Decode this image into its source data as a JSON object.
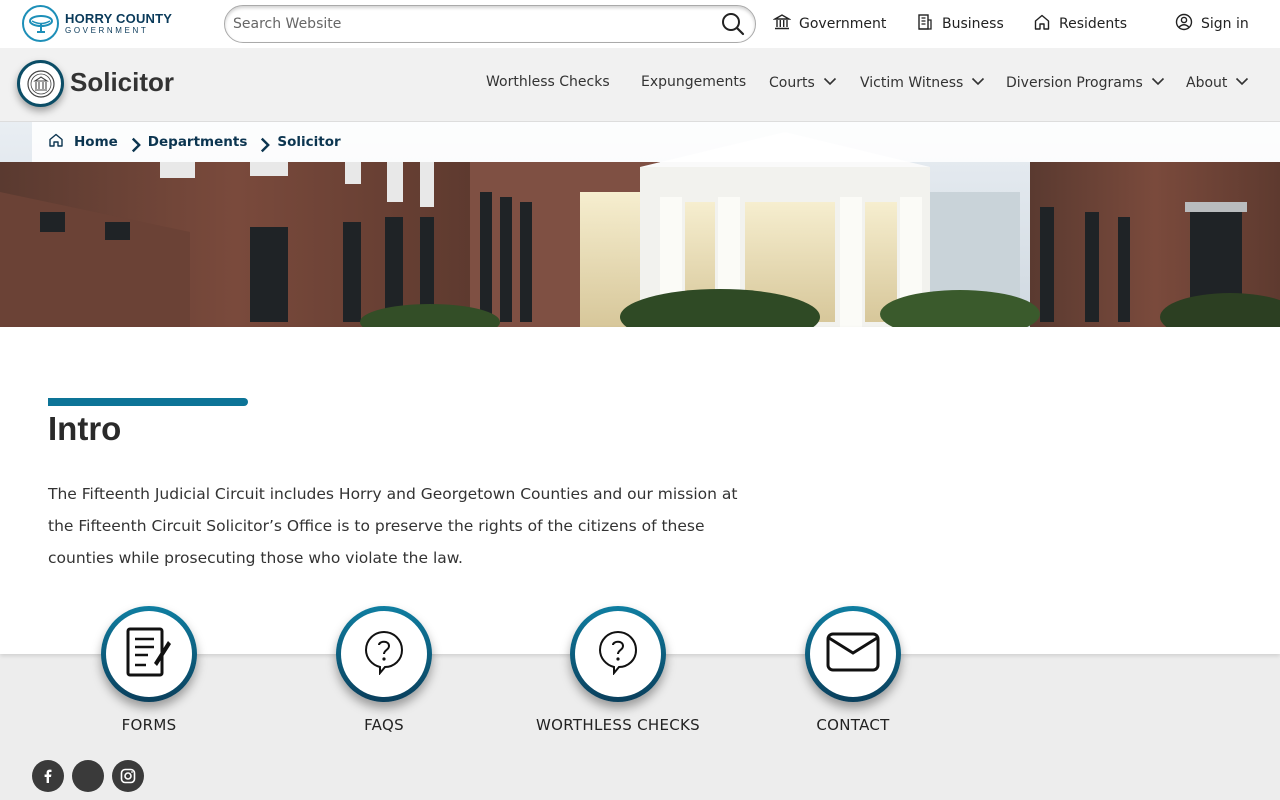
{
  "topbar": {
    "logo_line1": "HORRY COUNTY",
    "logo_line2": "GOVERNMENT",
    "search_placeholder": "Search Website",
    "links": [
      {
        "label": "Government",
        "icon": "government-building-icon"
      },
      {
        "label": "Business",
        "icon": "office-building-icon"
      },
      {
        "label": "Residents",
        "icon": "house-icon"
      },
      {
        "label": "Sign in",
        "icon": "user-circle-icon"
      }
    ]
  },
  "site": {
    "title": "Solicitor",
    "nav": [
      {
        "label": "Worthless Checks",
        "dropdown": false
      },
      {
        "label": "Expungements",
        "dropdown": false
      },
      {
        "label": "Courts",
        "dropdown": true
      },
      {
        "label": "Victim Witness",
        "dropdown": true
      },
      {
        "label": "Diversion Programs",
        "dropdown": true
      },
      {
        "label": "About",
        "dropdown": true
      }
    ]
  },
  "breadcrumb": [
    "Home",
    "Departments",
    "Solicitor"
  ],
  "intro": {
    "heading": "Intro",
    "text": "The Fifteenth Judicial Circuit includes Horry and Georgetown Counties and our mission at the Fifteenth Circuit Solicitor’s Office is to preserve the rights of the citizens of these counties while prosecuting those who violate the law."
  },
  "quicklinks": [
    {
      "label": "FORMS",
      "icon": "form-edit-icon"
    },
    {
      "label": "FAQS",
      "icon": "question-bubble-icon"
    },
    {
      "label": "WORTHLESS CHECKS",
      "icon": "question-bubble-icon"
    },
    {
      "label": "CONTACT",
      "icon": "envelope-icon"
    }
  ],
  "social": [
    "facebook-icon",
    "social-icon",
    "instagram-icon"
  ],
  "colors": {
    "accent": "#0d7497",
    "dark_teal": "#0a3f5c",
    "brand_blue": "#1d8fb8",
    "nav_text": "#0c3550"
  }
}
